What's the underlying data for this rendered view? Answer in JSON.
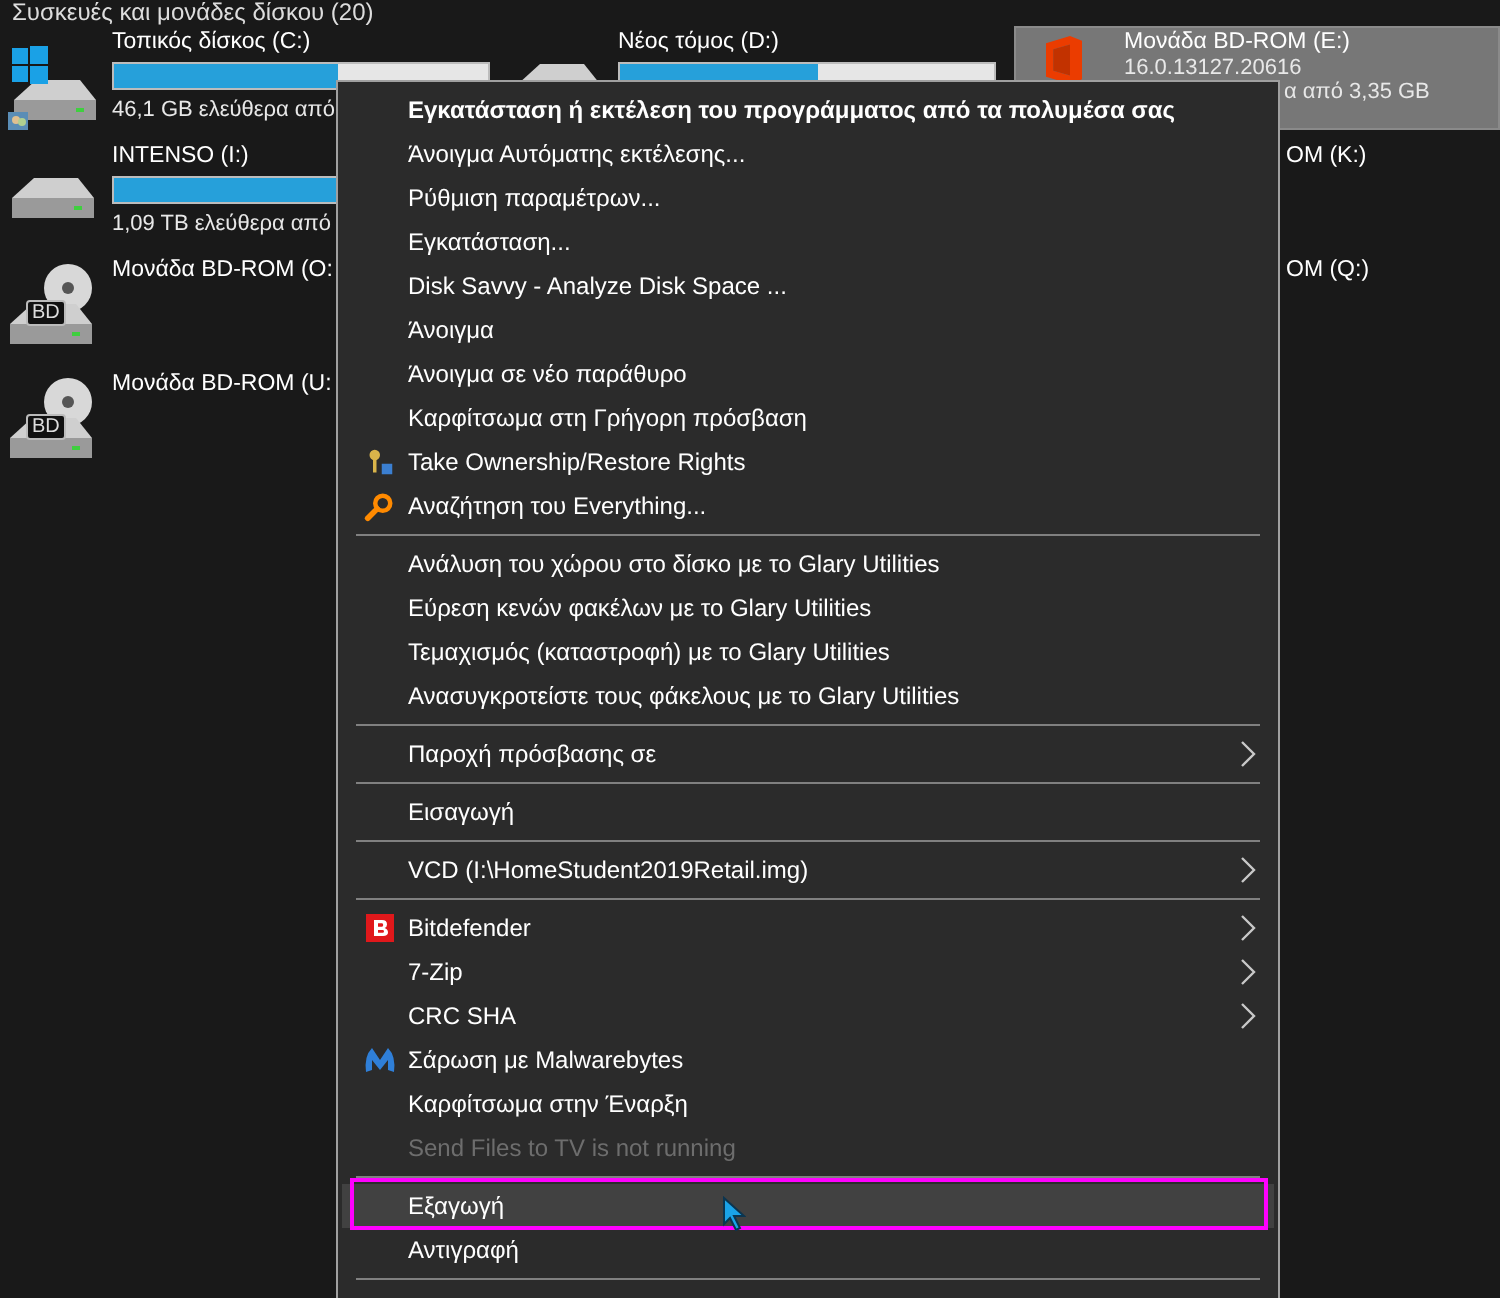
{
  "section_title": "Συσκευές και μονάδες δίσκου (20)",
  "drives": [
    {
      "kind": "system",
      "name": "Τοπικός δίσκος (C:)",
      "level": 0.6,
      "details": [
        "46,1 GB ελεύθερα από"
      ],
      "selected": false
    },
    {
      "kind": "disk",
      "name": "Νέος τόμος (D:)",
      "level": 0.53,
      "selected": false
    },
    {
      "kind": "office",
      "name": "Μονάδα BD-ROM (E:)",
      "details": [
        "16.0.13127.20616",
        "α από 3,35 GB"
      ],
      "selected": true
    },
    {
      "kind": "disk",
      "name": "INTENSO (I:)",
      "level": 0.6,
      "details": [
        "1,09 TB ελεύθερα από"
      ],
      "selected": false
    },
    {
      "kind": "empty"
    },
    {
      "kind": "partial",
      "name": "OM (K:)",
      "selected": false
    },
    {
      "kind": "optical",
      "name": "Μονάδα BD-ROM (O:",
      "badge": "BD",
      "selected": false
    },
    {
      "kind": "empty"
    },
    {
      "kind": "partial",
      "name": "OM (Q:)",
      "selected": false
    },
    {
      "kind": "optical",
      "name": "Μονάδα BD-ROM (U:",
      "badge": "BD",
      "selected": false
    }
  ],
  "context_menu": [
    {
      "kind": "item",
      "label": "Εγκατάσταση ή εκτέλεση του προγράμματος από τα πολυμέσα σας",
      "bold": true,
      "selected": false,
      "disabled": false
    },
    {
      "kind": "item",
      "label": "Άνοιγμα Αυτόματης εκτέλεσης...",
      "selected": false,
      "disabled": false
    },
    {
      "kind": "item",
      "label": "Ρύθμιση παραμέτρων...",
      "selected": false,
      "disabled": false
    },
    {
      "kind": "item",
      "label": "Εγκατάσταση...",
      "selected": false,
      "disabled": false
    },
    {
      "kind": "item",
      "label": "Disk Savvy - Analyze Disk Space ...",
      "selected": false,
      "disabled": false
    },
    {
      "kind": "item",
      "label": "Άνοιγμα",
      "selected": false,
      "disabled": false
    },
    {
      "kind": "item",
      "label": "Άνοιγμα σε νέο παράθυρο",
      "selected": false,
      "disabled": false
    },
    {
      "kind": "item",
      "label": "Καρφίτσωμα στη Γρήγορη πρόσβαση",
      "selected": false,
      "disabled": false
    },
    {
      "kind": "keys-item",
      "label": "Take Ownership/Restore Rights",
      "selected": false,
      "disabled": false
    },
    {
      "kind": "magnifier-item",
      "label": "Αναζήτηση του Everything...",
      "selected": false,
      "disabled": false
    },
    {
      "kind": "separator"
    },
    {
      "kind": "item",
      "label": "Ανάλυση του χώρου στο δίσκο με το Glary Utilities",
      "selected": false,
      "disabled": false
    },
    {
      "kind": "item",
      "label": "Εύρεση κενών φακέλων με το Glary Utilities",
      "selected": false,
      "disabled": false
    },
    {
      "kind": "item",
      "label": "Τεμαχισμός (καταστροφή) με το Glary Utilities",
      "selected": false,
      "disabled": false
    },
    {
      "kind": "item",
      "label": "Ανασυγκροτείστε τους φάκελους με το Glary Utilities",
      "selected": false,
      "disabled": false
    },
    {
      "kind": "separator"
    },
    {
      "kind": "item",
      "label": "Παροχή πρόσβασης σε",
      "submenu": true,
      "selected": false,
      "disabled": false
    },
    {
      "kind": "separator"
    },
    {
      "kind": "item",
      "label": "Εισαγωγή",
      "selected": false,
      "disabled": false
    },
    {
      "kind": "separator"
    },
    {
      "kind": "item",
      "label": "VCD (I:\\HomeStudent2019Retail.img)",
      "submenu": true,
      "selected": false,
      "disabled": false
    },
    {
      "kind": "separator"
    },
    {
      "kind": "b-item",
      "label": "Bitdefender",
      "submenu": true,
      "selected": false,
      "disabled": false
    },
    {
      "kind": "item",
      "label": "7-Zip",
      "submenu": true,
      "selected": false,
      "disabled": false
    },
    {
      "kind": "item",
      "label": "CRC SHA",
      "submenu": true,
      "selected": false,
      "disabled": false
    },
    {
      "kind": "wing-item",
      "label": "Σάρωση με Malwarebytes",
      "selected": false,
      "disabled": false
    },
    {
      "kind": "item",
      "label": "Καρφίτσωμα στην Έναρξη",
      "selected": false,
      "disabled": false
    },
    {
      "kind": "item",
      "label": "Send Files to TV is not running",
      "selected": false,
      "disabled": true
    },
    {
      "kind": "separator"
    },
    {
      "kind": "item",
      "label": "Εξαγωγή",
      "selected": true,
      "disabled": false,
      "annotated": true
    },
    {
      "kind": "item",
      "label": "Αντιγραφή",
      "selected": false,
      "disabled": false
    },
    {
      "kind": "separator"
    }
  ]
}
